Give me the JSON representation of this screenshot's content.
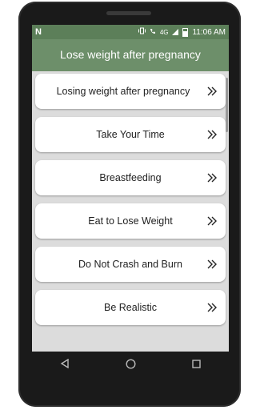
{
  "status_bar": {
    "app_icon": "N",
    "network": "4G",
    "time": "11:06 AM",
    "icons": [
      "vibrate-icon",
      "call-icon",
      "signal-icon",
      "battery-icon"
    ]
  },
  "app_bar": {
    "title": "Lose weight after pregnancy"
  },
  "list": {
    "items": [
      {
        "label": "Losing weight after pregnancy"
      },
      {
        "label": "Take Your Time"
      },
      {
        "label": "Breastfeeding"
      },
      {
        "label": "Eat to Lose Weight"
      },
      {
        "label": "Do Not Crash and Burn"
      },
      {
        "label": "Be Realistic"
      }
    ],
    "chevron_icon": "double-chevron-right-icon"
  },
  "nav_bar": {
    "buttons": [
      "back-icon",
      "home-icon",
      "recents-icon"
    ]
  },
  "colors": {
    "app_bar": "#6d8f6a",
    "status_bar": "#5c7f59",
    "list_bg": "#dcdcdc",
    "card": "#ffffff"
  }
}
